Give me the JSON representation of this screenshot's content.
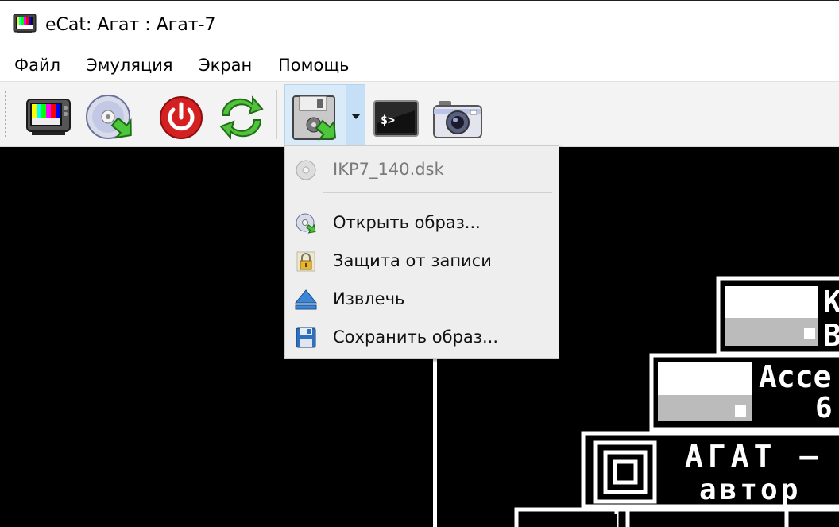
{
  "window": {
    "title": "eCat: Агат : Агат-7"
  },
  "menubar": {
    "items": [
      {
        "label": "Файл"
      },
      {
        "label": "Эмуляция"
      },
      {
        "label": "Экран"
      },
      {
        "label": "Помощь"
      }
    ]
  },
  "toolbar": {
    "buttons": [
      {
        "icon": "tv-monitor-icon"
      },
      {
        "icon": "cd-open-icon"
      },
      {
        "icon": "power-icon"
      },
      {
        "icon": "reset-icon"
      },
      {
        "icon": "floppy-disk-icon",
        "has_dropdown": true,
        "active": true
      },
      {
        "icon": "terminal-icon"
      },
      {
        "icon": "camera-icon"
      }
    ]
  },
  "disk_menu": {
    "current_image": "IKP7_140.dsk",
    "items": [
      {
        "label": "Открыть образ...",
        "icon": "cd-open-icon"
      },
      {
        "label": "Защита от записи",
        "icon": "lock-icon"
      },
      {
        "label": "Извлечь",
        "icon": "eject-icon"
      },
      {
        "label": "Сохранить образ...",
        "icon": "save-icon"
      }
    ]
  },
  "emulator_screen": {
    "text_lines": [
      "К",
      "В",
      "Ассе",
      "6",
      "АГАТ –",
      "автор"
    ]
  },
  "colors": {
    "menu_hover_bg": "#d9ebf9",
    "screen_bg": "#000000",
    "screen_fg": "#ffffff"
  }
}
